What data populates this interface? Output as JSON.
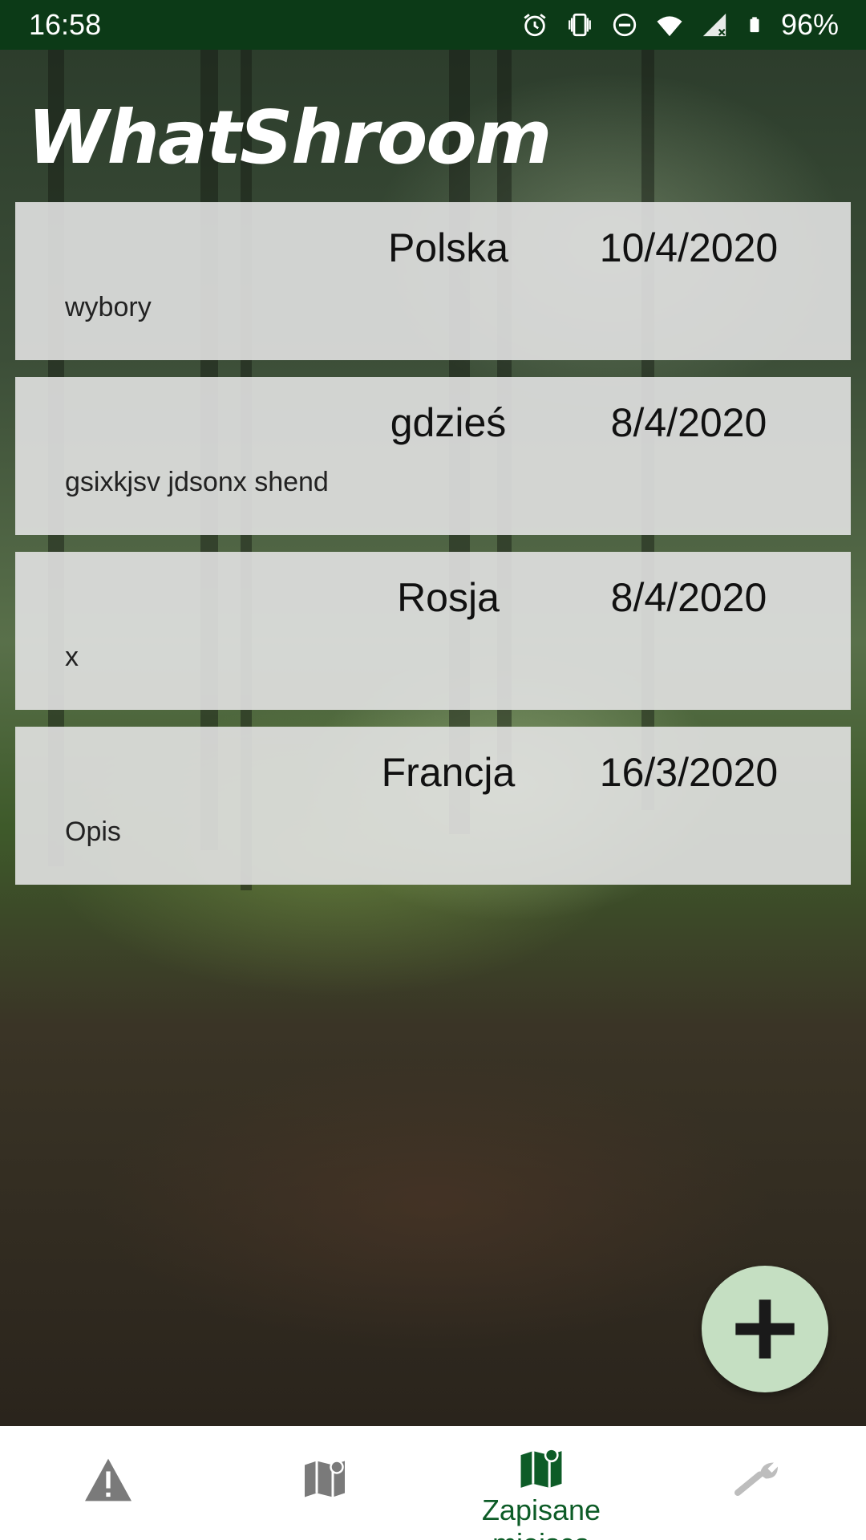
{
  "status_bar": {
    "time": "16:58",
    "battery": "96%",
    "icons": [
      "alarm-icon",
      "vibrate-icon",
      "do-not-disturb-icon",
      "wifi-icon",
      "signal-icon",
      "battery-icon"
    ]
  },
  "app": {
    "title": "WhatShroom"
  },
  "places": [
    {
      "name": "Polska",
      "date": "10/4/2020",
      "description": "wybory"
    },
    {
      "name": "gdzieś",
      "date": "8/4/2020",
      "description": "gsixkjsv jdsonx shend"
    },
    {
      "name": "Rosja",
      "date": "8/4/2020",
      "description": "x"
    },
    {
      "name": "Francja",
      "date": "16/3/2020",
      "description": "Opis"
    }
  ],
  "fab": {
    "icon": "plus-icon"
  },
  "bottom_nav": {
    "items": [
      {
        "icon": "warning-icon",
        "label": ""
      },
      {
        "icon": "map-icon",
        "label": ""
      },
      {
        "icon": "saved-map-icon",
        "label": "Zapisane miejsca",
        "active": true
      },
      {
        "icon": "wrench-icon",
        "label": ""
      }
    ]
  },
  "colors": {
    "status_bar": "#0c3a17",
    "accent": "#0d5c27",
    "fab": "#c5dfc2",
    "card": "#e2e2e2",
    "inactive_icon": "#7a7a7a"
  }
}
